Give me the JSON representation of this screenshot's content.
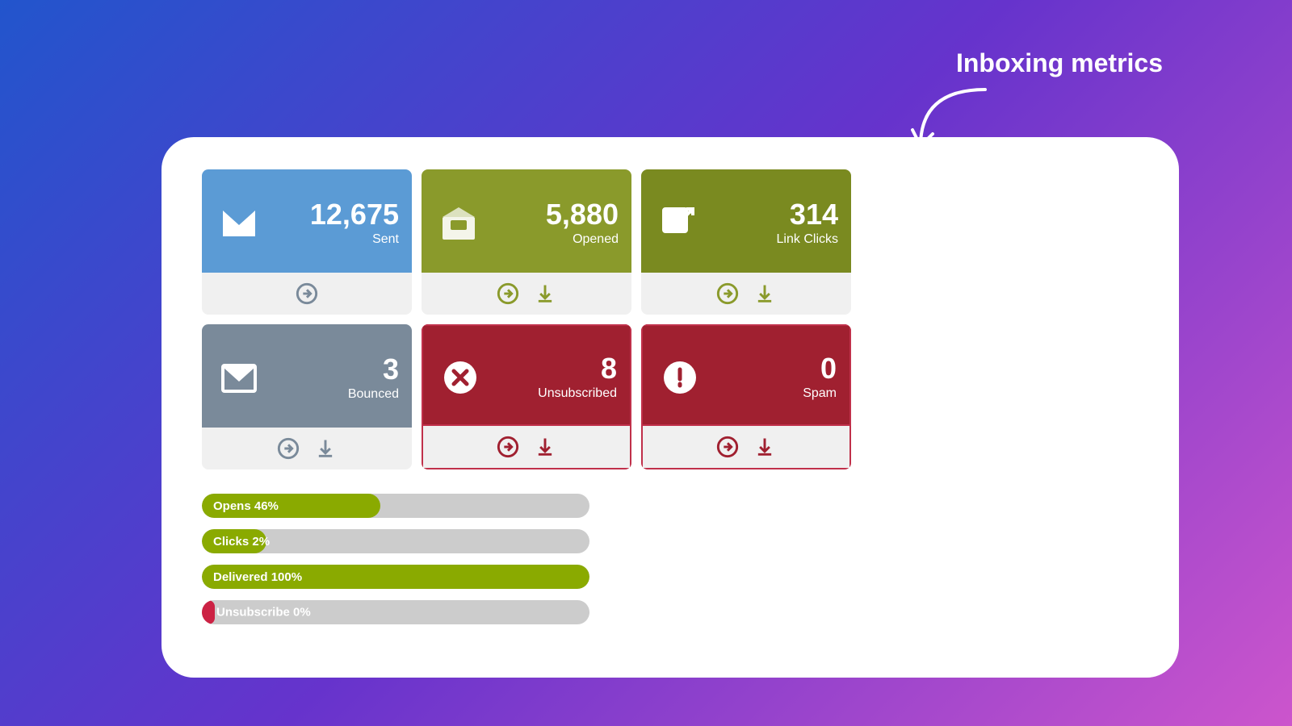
{
  "heading": {
    "title": "Inboxing metrics"
  },
  "metrics": [
    {
      "id": "sent",
      "value": "12,675",
      "label": "Sent",
      "color": "blue",
      "icon": "envelope",
      "actions": [
        "arrow-right"
      ]
    },
    {
      "id": "opened",
      "value": "5,880",
      "label": "Opened",
      "color": "olive",
      "icon": "envelope-open",
      "actions": [
        "arrow-right",
        "download"
      ]
    },
    {
      "id": "link-clicks",
      "value": "314",
      "label": "Link Clicks",
      "color": "olive",
      "icon": "external-link",
      "actions": [
        "arrow-right",
        "download"
      ]
    },
    {
      "id": "bounced",
      "value": "3",
      "label": "Bounced",
      "color": "gray",
      "icon": "envelope",
      "actions": [
        "arrow-right",
        "download"
      ]
    },
    {
      "id": "unsubscribed",
      "value": "8",
      "label": "Unsubscribed",
      "color": "red",
      "icon": "x-circle",
      "actions": [
        "arrow-right",
        "download"
      ]
    },
    {
      "id": "spam",
      "value": "0",
      "label": "Spam",
      "color": "red",
      "icon": "exclamation-circle",
      "actions": [
        "arrow-right",
        "download"
      ]
    }
  ],
  "progress_bars": [
    {
      "id": "opens",
      "label": "Opens",
      "percent": 46,
      "percent_label": "46%",
      "color": "green",
      "fill_width": 46
    },
    {
      "id": "clicks",
      "label": "Clicks",
      "percent": 2,
      "percent_label": "2%",
      "color": "green",
      "fill_width": 2
    },
    {
      "id": "delivered",
      "label": "Delivered",
      "percent": 100,
      "percent_label": "100%",
      "color": "green",
      "fill_width": 100
    },
    {
      "id": "unsubscribe",
      "label": "Unsubscribe",
      "percent": 0,
      "percent_label": "0%",
      "color": "red",
      "fill_width": 2
    }
  ]
}
